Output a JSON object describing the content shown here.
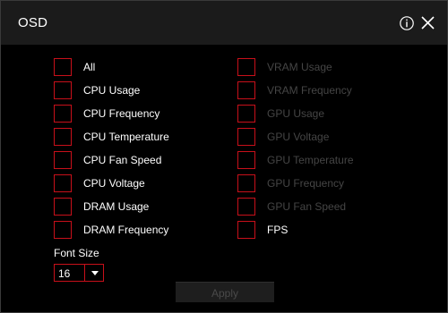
{
  "window": {
    "title": "OSD",
    "accent": "#c8101a",
    "disabled_text": "#454545",
    "icons": [
      "info-icon",
      "close-icon"
    ]
  },
  "options": {
    "left": [
      {
        "label": "All",
        "checked": false,
        "enabled": true
      },
      {
        "label": "CPU Usage",
        "checked": false,
        "enabled": true
      },
      {
        "label": "CPU Frequency",
        "checked": false,
        "enabled": true
      },
      {
        "label": "CPU Temperature",
        "checked": false,
        "enabled": true
      },
      {
        "label": "CPU Fan Speed",
        "checked": false,
        "enabled": true
      },
      {
        "label": "CPU Voltage",
        "checked": false,
        "enabled": true
      },
      {
        "label": "DRAM Usage",
        "checked": false,
        "enabled": true
      },
      {
        "label": "DRAM Frequency",
        "checked": false,
        "enabled": true
      }
    ],
    "right": [
      {
        "label": "VRAM Usage",
        "checked": false,
        "enabled": false
      },
      {
        "label": "VRAM Frequency",
        "checked": false,
        "enabled": false
      },
      {
        "label": "GPU Usage",
        "checked": false,
        "enabled": false
      },
      {
        "label": "GPU Voltage",
        "checked": false,
        "enabled": false
      },
      {
        "label": "GPU Temperature",
        "checked": false,
        "enabled": false
      },
      {
        "label": "GPU Frequency",
        "checked": false,
        "enabled": false
      },
      {
        "label": "GPU Fan Speed",
        "checked": false,
        "enabled": false
      },
      {
        "label": "FPS",
        "checked": false,
        "enabled": true
      }
    ]
  },
  "font_size": {
    "label": "Font Size",
    "value": "16"
  },
  "apply": {
    "label": "Apply",
    "enabled": false
  }
}
